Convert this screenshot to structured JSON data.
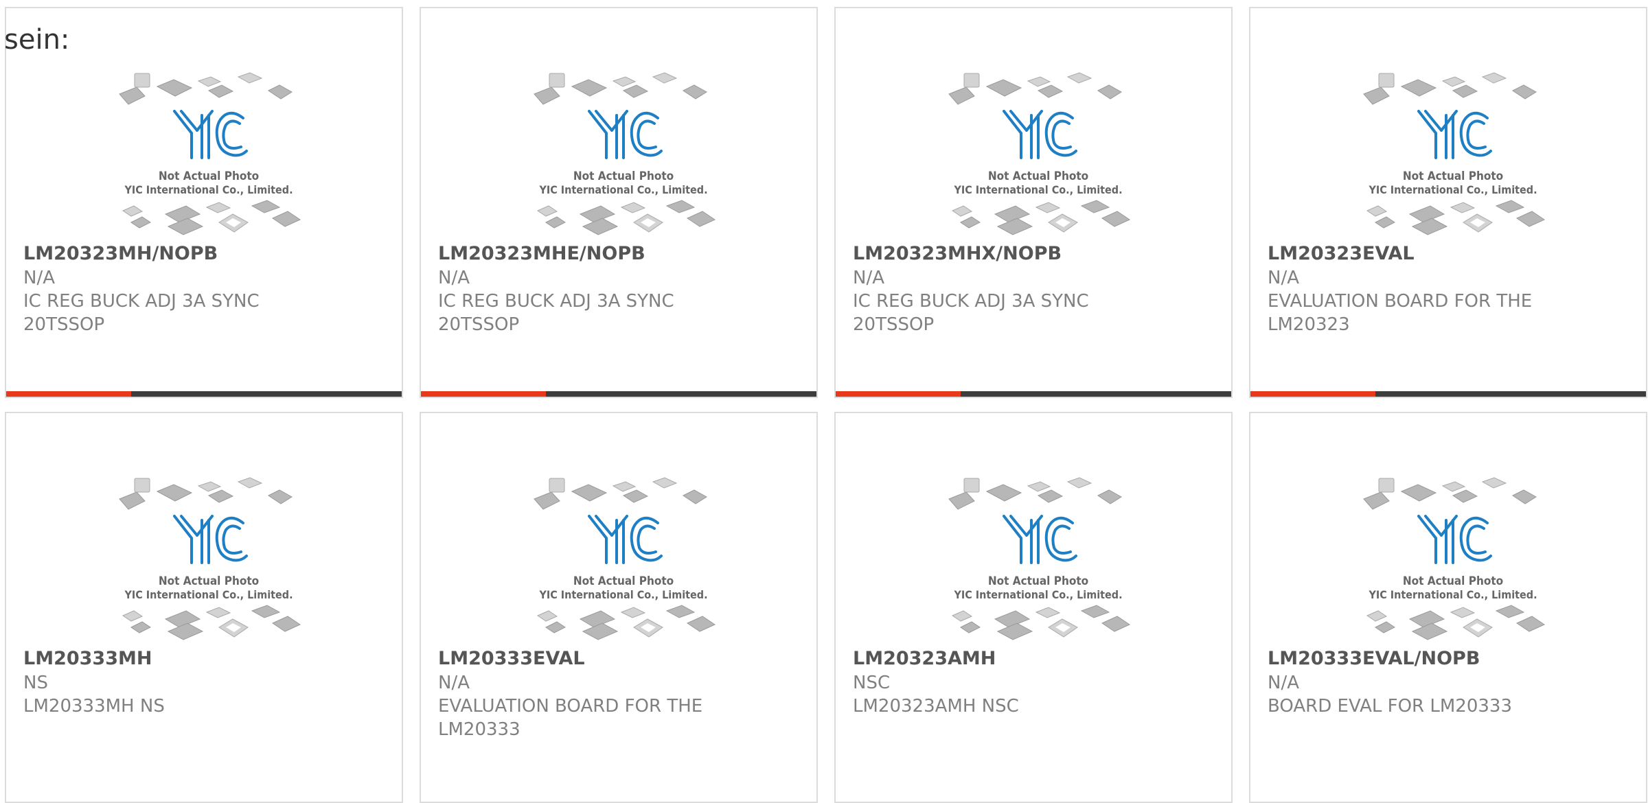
{
  "intro_text": "sein:",
  "photo": {
    "logo": "YIC",
    "caption_line1": "Not Actual Photo",
    "caption_line2": "YIC International Co., Limited."
  },
  "colors": {
    "accent": "#e8391a",
    "bar_dark": "#3d3d3d",
    "logo_blue": "#1f7fc4"
  },
  "products": [
    {
      "part": "LM20323MH/NOPB",
      "maker": "N/A",
      "desc": "IC REG BUCK ADJ 3A SYNC 20TSSOP"
    },
    {
      "part": "LM20323MHE/NOPB",
      "maker": "N/A",
      "desc": "IC REG BUCK ADJ 3A SYNC 20TSSOP"
    },
    {
      "part": "LM20323MHX/NOPB",
      "maker": "N/A",
      "desc": "IC REG BUCK ADJ 3A SYNC 20TSSOP"
    },
    {
      "part": "LM20323EVAL",
      "maker": "N/A",
      "desc": "EVALUATION BOARD FOR THE LM20323"
    },
    {
      "part": "LM20333MH",
      "maker": "NS",
      "desc": "LM20333MH NS"
    },
    {
      "part": "LM20333EVAL",
      "maker": "N/A",
      "desc": "EVALUATION BOARD FOR THE LM20333"
    },
    {
      "part": "LM20323AMH",
      "maker": "NSC",
      "desc": "LM20323AMH NSC"
    },
    {
      "part": "LM20333EVAL/NOPB",
      "maker": "N/A",
      "desc": "BOARD EVAL FOR LM20333"
    }
  ]
}
